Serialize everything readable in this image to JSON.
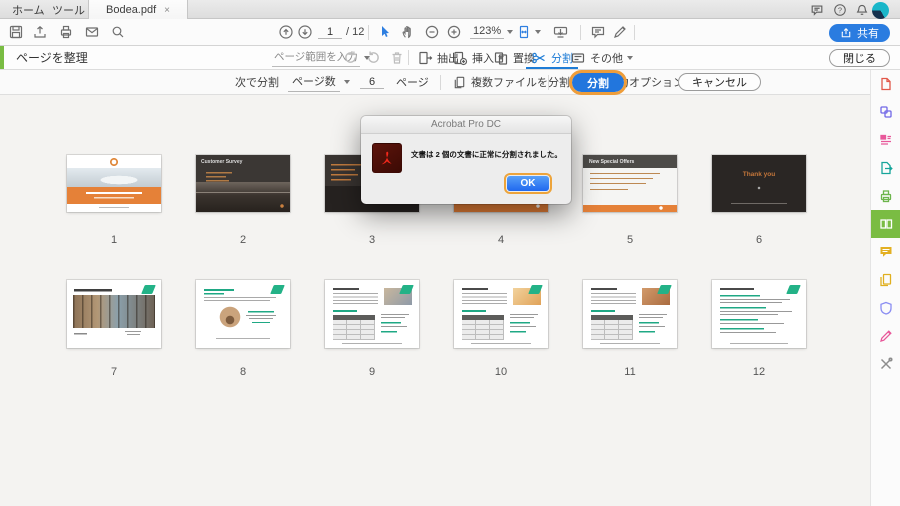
{
  "tabbar": {
    "home": "ホーム",
    "tools": "ツール",
    "document": "Bodea.pdf",
    "close": "×"
  },
  "header": {
    "page_current": "1",
    "page_total": "/ 12",
    "zoom": "123%",
    "share": "共有",
    "help_glyph": "?"
  },
  "organize": {
    "title": "ページを整理",
    "range_placeholder": "ページ範囲を入力",
    "extract": "抽出",
    "insert": "挿入",
    "replace": "置換",
    "split": "分割",
    "more": "その他",
    "close": "閉じる"
  },
  "splitbar": {
    "label": "次で分割",
    "mode": "ページ数",
    "count": "6",
    "unit": "ページ",
    "multi": "複数ファイルを分割",
    "output": "出力オプション",
    "split": "分割",
    "cancel": "キャンセル"
  },
  "dialog": {
    "app": "Acrobat Pro DC",
    "message": "文書は 2 個の文書に正常に分割されました。",
    "ok": "OK"
  },
  "thumbs": {
    "p2_title": "Customer Survey",
    "p5_title": "New Special Offers",
    "p6_title": "Thank you"
  },
  "pages": [
    "1",
    "2",
    "3",
    "4",
    "5",
    "6",
    "7",
    "8",
    "9",
    "10",
    "11",
    "12"
  ],
  "colors": {
    "accent_green": "#79bc43",
    "accent_blue": "#1e7cd6",
    "highlight_orange": "#ee9d3a",
    "slide_orange": "#e58138",
    "teal": "#1fa884"
  }
}
